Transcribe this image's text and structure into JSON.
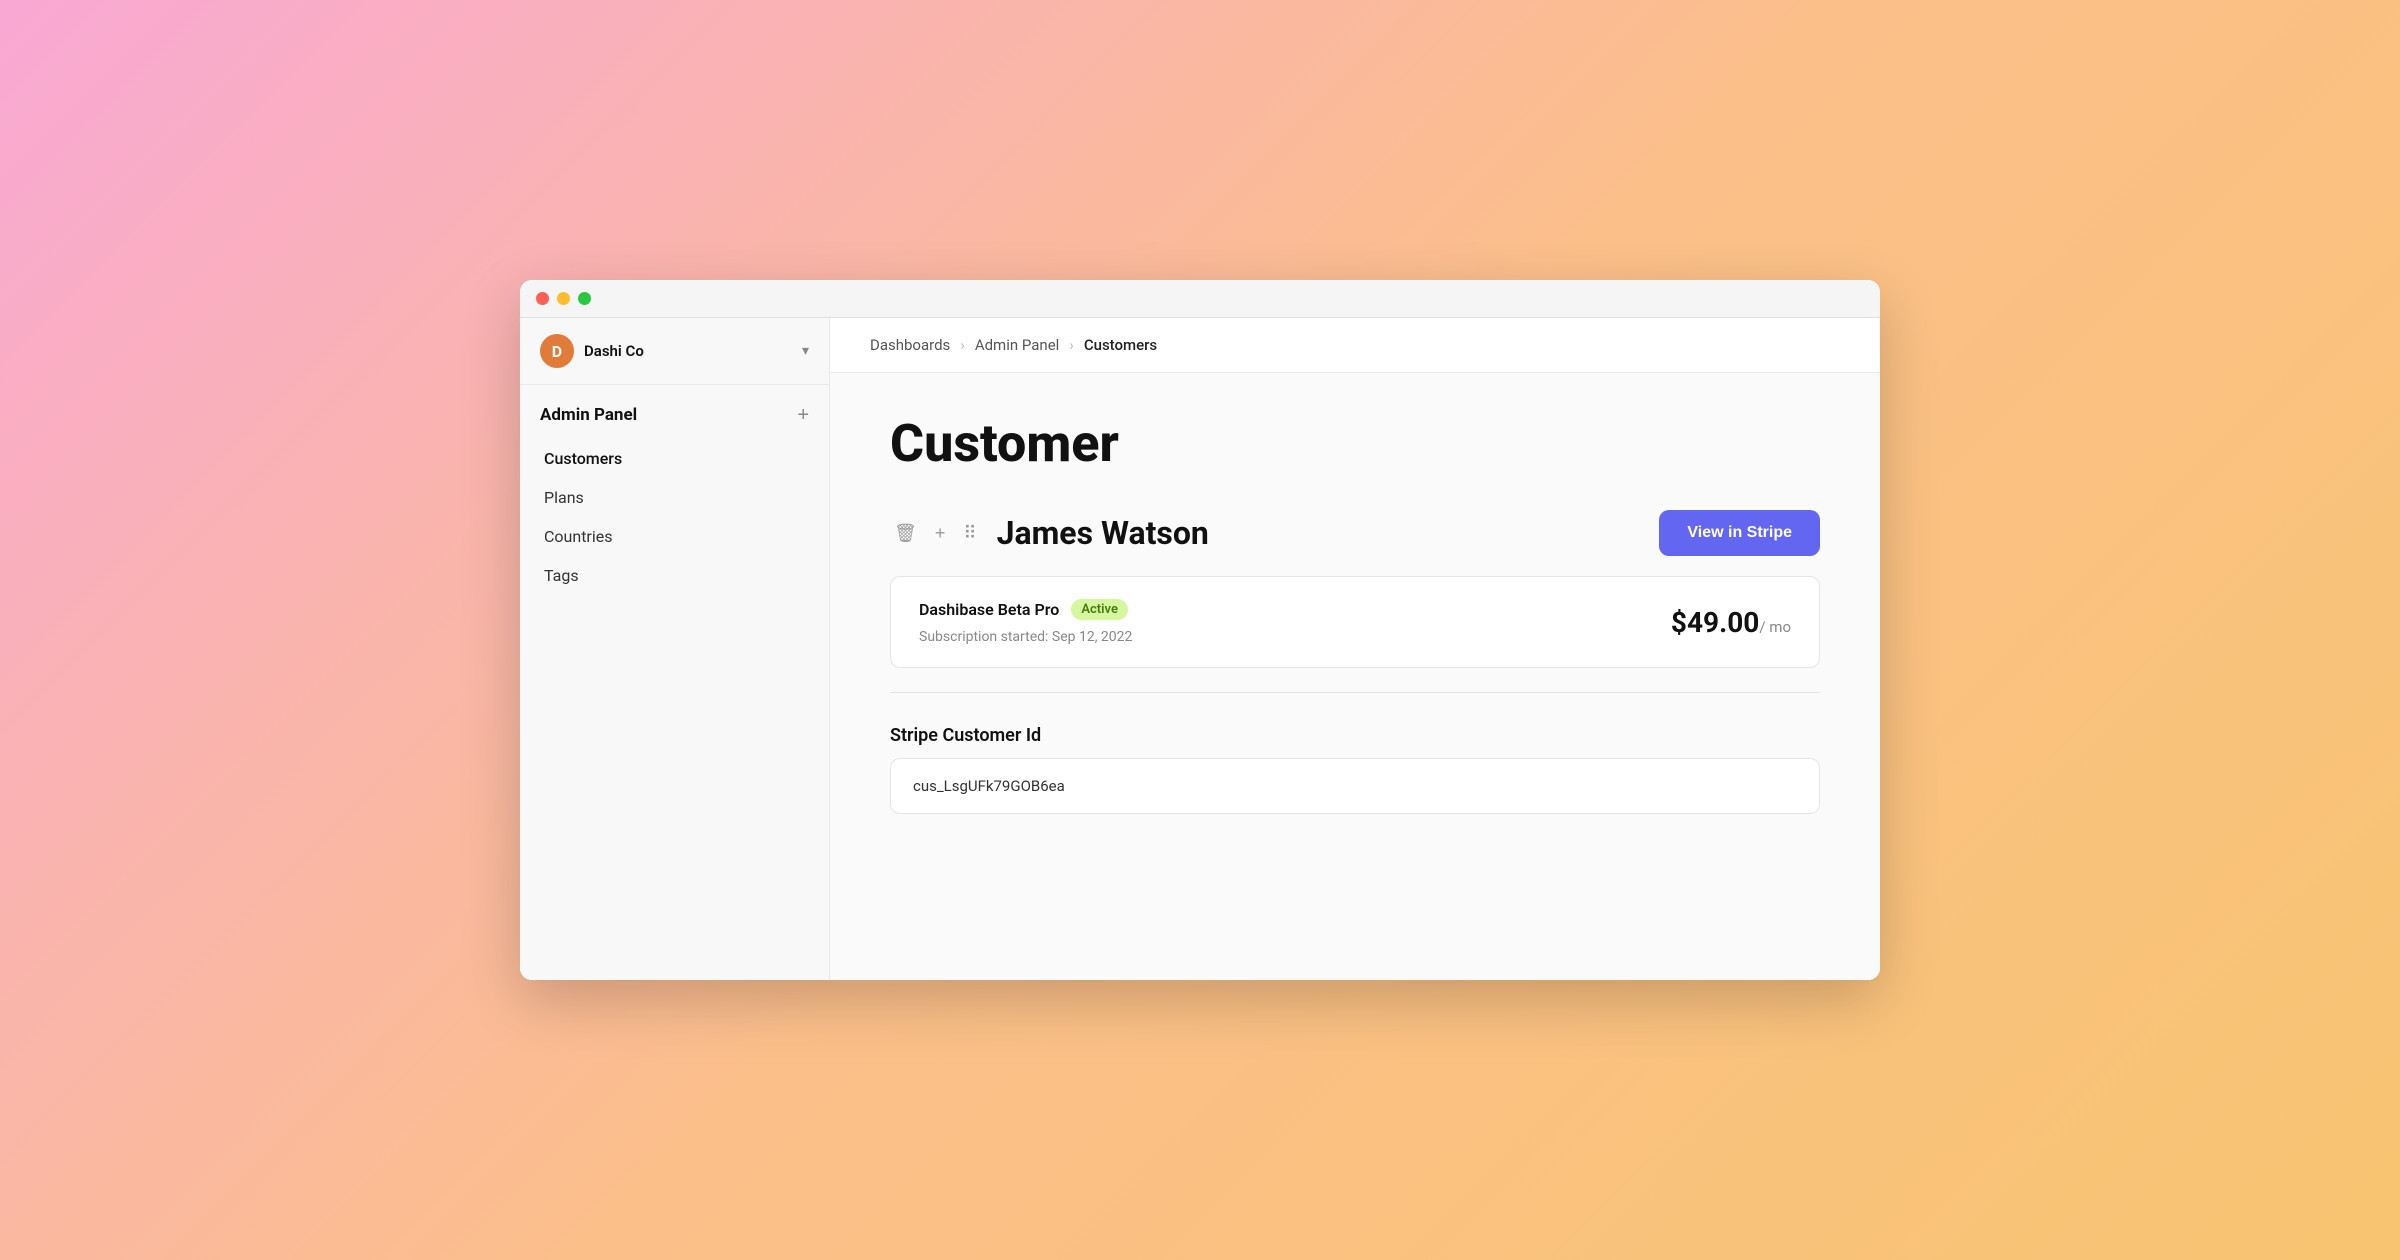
{
  "window": {
    "controls": {
      "red": "red",
      "yellow": "yellow",
      "green": "green"
    }
  },
  "sidebar": {
    "brand": {
      "initial": "D",
      "name": "Dashi Co",
      "chevron": "▾"
    },
    "section_title": "Admin Panel",
    "add_button": "+",
    "nav_items": [
      {
        "label": "Customers",
        "active": true
      },
      {
        "label": "Plans",
        "active": false
      },
      {
        "label": "Countries",
        "active": false
      },
      {
        "label": "Tags",
        "active": false
      }
    ]
  },
  "breadcrumb": {
    "items": [
      {
        "label": "Dashboards"
      },
      {
        "label": "Admin Panel"
      },
      {
        "label": "Customers"
      }
    ],
    "separator": "›"
  },
  "main": {
    "page_title": "Customer",
    "record": {
      "name": "James Watson",
      "stripe_button": "View in Stripe"
    },
    "subscription": {
      "plan_name": "Dashibase Beta Pro",
      "status": "Active",
      "start_date": "Subscription started: Sep 12, 2022",
      "price": "$49.00",
      "period": "/ mo"
    },
    "stripe_customer_id": {
      "label": "Stripe Customer Id",
      "value": "cus_LsgUFk79GOB6ea"
    }
  },
  "icons": {
    "trash": "🗑",
    "plus": "+",
    "drag": "⠿"
  }
}
